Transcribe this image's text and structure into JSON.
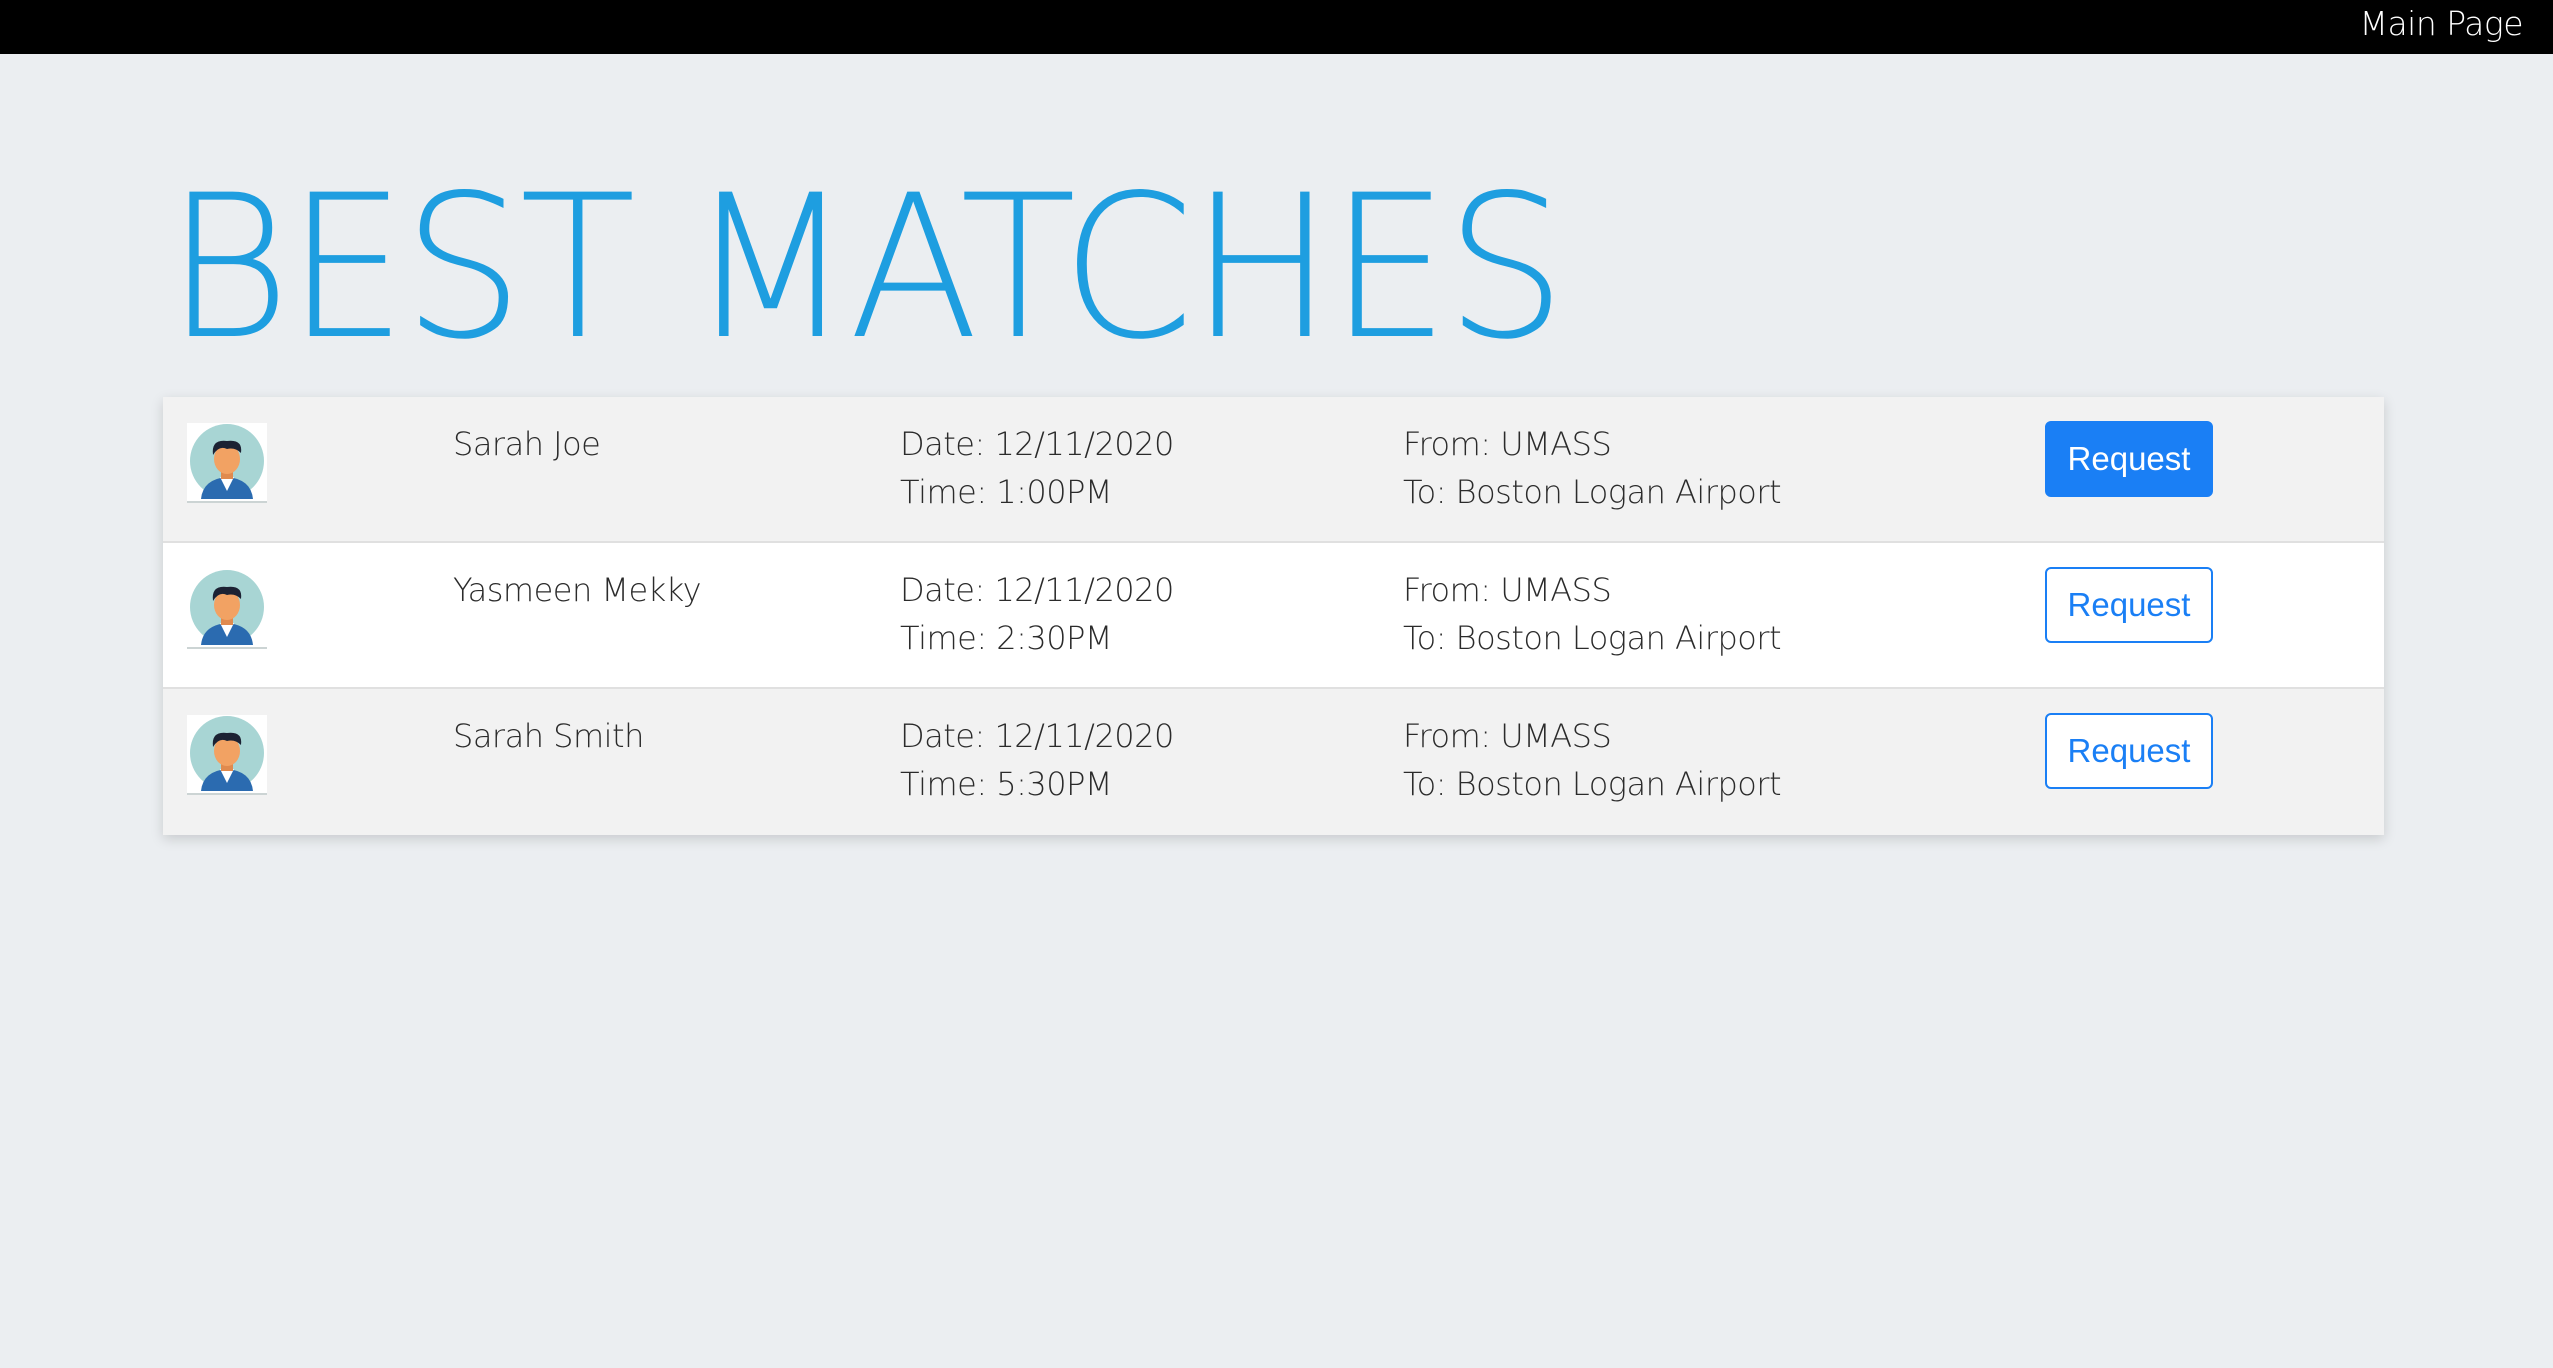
{
  "topbar": {
    "main_page_label": "Main Page"
  },
  "page": {
    "title": "BEST MATCHES"
  },
  "matches": [
    {
      "avatar_icon": "user-avatar-icon",
      "name": "Sarah Joe",
      "date": "Date: 12/11/2020",
      "time": "Time: 1:00PM",
      "from": "From: UMASS",
      "to": "To: Boston Logan Airport",
      "button_label": "Request",
      "button_style": "filled"
    },
    {
      "avatar_icon": "user-avatar-icon",
      "name": "Yasmeen Mekky",
      "date": "Date: 12/11/2020",
      "time": "Time: 2:30PM",
      "from": "From: UMASS",
      "to": "To: Boston Logan Airport",
      "button_label": "Request",
      "button_style": "outline"
    },
    {
      "avatar_icon": "user-avatar-icon",
      "name": "Sarah Smith",
      "date": "Date: 12/11/2020",
      "time": "Time: 5:30PM",
      "from": "From: UMASS",
      "to": "To: Boston Logan Airport",
      "button_label": "Request",
      "button_style": "outline"
    }
  ],
  "colors": {
    "title": "#1e9ee0",
    "button_primary": "#1a7ff5",
    "background": "#ebeef1",
    "topbar": "#000000"
  }
}
